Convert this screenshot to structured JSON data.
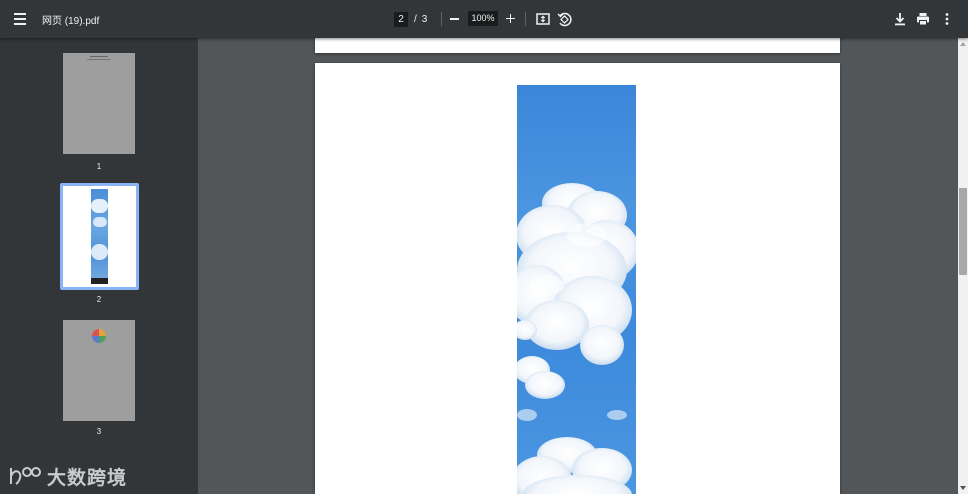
{
  "toolbar": {
    "title": "网页 (19).pdf",
    "current_page": "2",
    "page_separator": "/",
    "total_pages": "3",
    "zoom": "100%",
    "icons": {
      "menu": "hamburger-menu-icon",
      "zoom_out": "minus-icon",
      "zoom_in": "plus-icon",
      "fit": "fit-to-page-icon",
      "rotate": "rotate-counterclockwise-icon",
      "download": "download-icon",
      "print": "print-icon",
      "more": "more-vertical-icon"
    }
  },
  "sidebar": {
    "thumbnails": [
      {
        "label": "1",
        "selected": false
      },
      {
        "label": "2",
        "selected": true
      },
      {
        "label": "3",
        "selected": false
      }
    ],
    "selected_color": "#8ab4f8"
  },
  "watermark": {
    "text": "大数跨境"
  },
  "colors": {
    "toolbar_bg": "#323639",
    "viewer_bg": "#525659",
    "sky_blue": "#3b86d9"
  }
}
